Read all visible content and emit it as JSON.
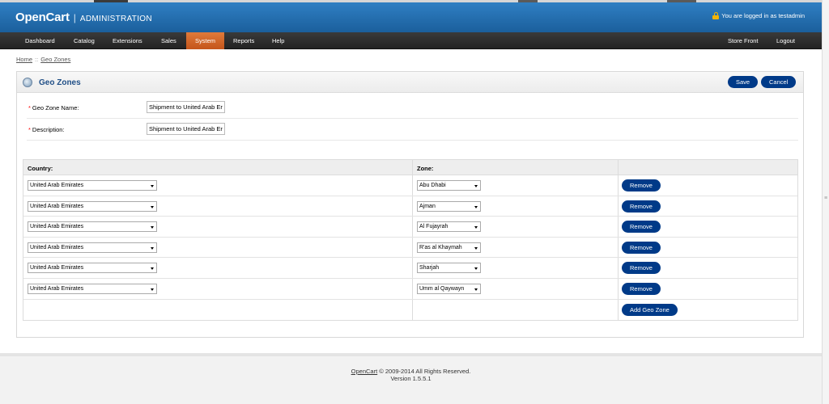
{
  "header": {
    "brand": "OpenCart",
    "separator": "|",
    "section": "ADMINISTRATION",
    "login_text": "You are logged in as testadmin",
    "icon": "lock-icon"
  },
  "nav": {
    "items": [
      "Dashboard",
      "Catalog",
      "Extensions",
      "Sales",
      "System",
      "Reports",
      "Help"
    ],
    "active": "System",
    "right_items": [
      "Store Front",
      "Logout"
    ]
  },
  "breadcrumb": {
    "home": "Home",
    "separator": "::",
    "current": "Geo Zones"
  },
  "panel": {
    "title": "Geo Zones",
    "icon": "globe-icon",
    "save_label": "Save",
    "cancel_label": "Cancel"
  },
  "form": {
    "name_label": "Geo Zone Name:",
    "name_value": "Shipment to United Arab Er",
    "description_label": "Description:",
    "description_value": "Shipment to United Arab Er",
    "required_marker": "*"
  },
  "zones_table": {
    "country_header": "Country:",
    "zone_header": "Zone:",
    "remove_label": "Remove",
    "add_label": "Add Geo Zone",
    "rows": [
      {
        "country": "United Arab Emirates",
        "zone": "Abu Dhabi"
      },
      {
        "country": "United Arab Emirates",
        "zone": "Ajman"
      },
      {
        "country": "United Arab Emirates",
        "zone": "Al Fujayrah"
      },
      {
        "country": "United Arab Emirates",
        "zone": "R'as al Khaymah"
      },
      {
        "country": "United Arab Emirates",
        "zone": "Sharjah"
      },
      {
        "country": "United Arab Emirates",
        "zone": "Umm al Qaywayn"
      }
    ]
  },
  "footer": {
    "link": "OpenCart",
    "copyright": "© 2009-2014 All Rights Reserved.",
    "version": "Version 1.5.5.1"
  },
  "colors": {
    "header_blue": "#1b5f9c",
    "nav_dark": "#2a2a2a",
    "active_tab": "#d0621f",
    "button_blue": "#003a88",
    "title_blue": "#1f4e86"
  }
}
